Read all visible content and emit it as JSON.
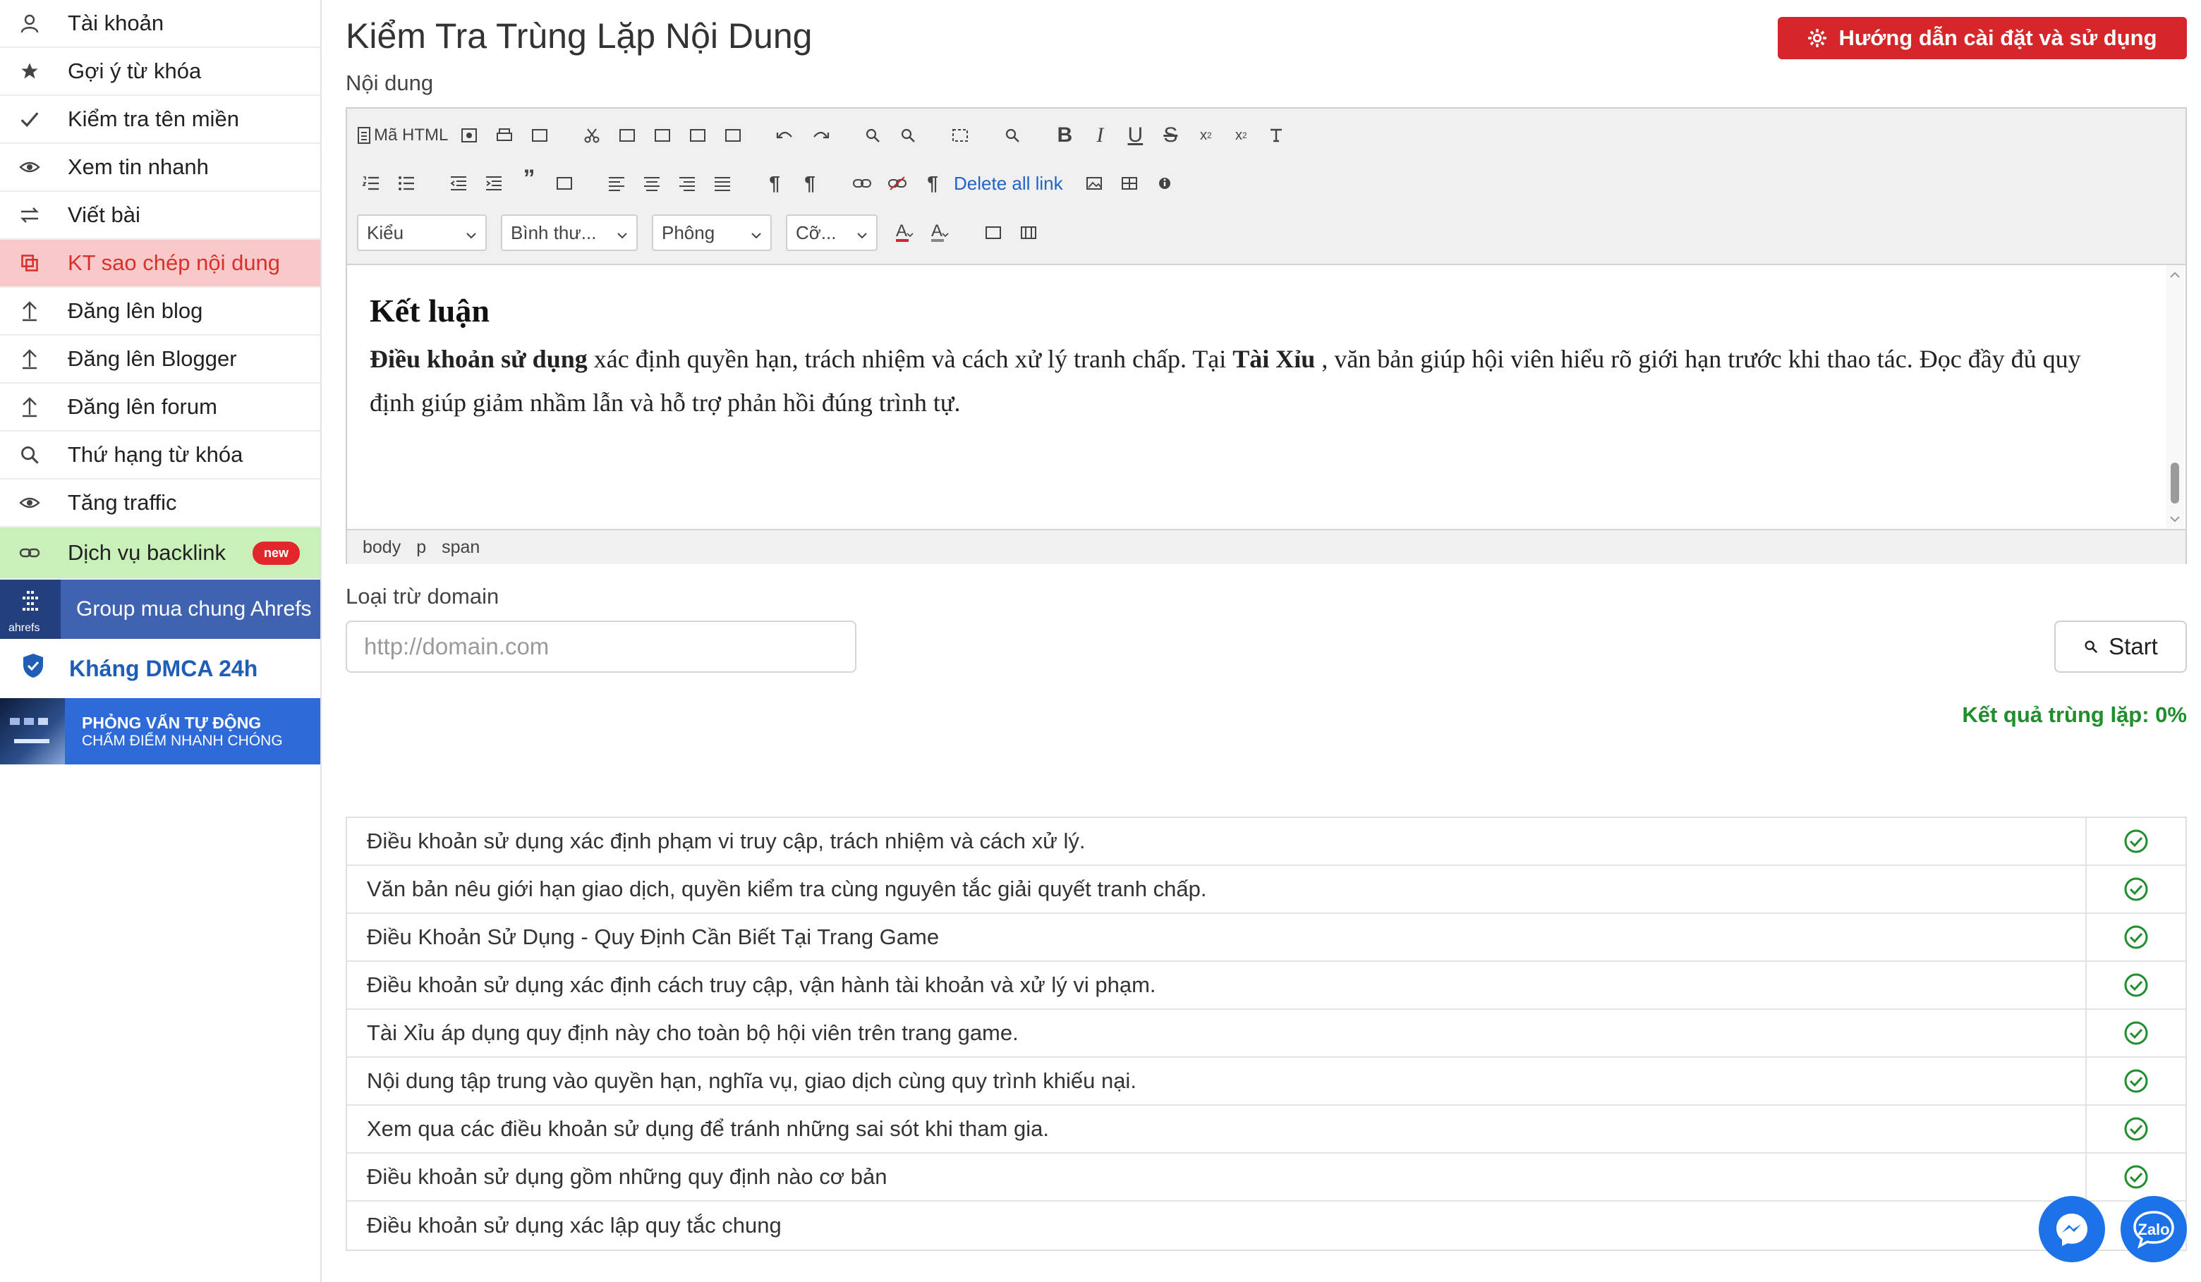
{
  "sidebar": {
    "items": [
      {
        "label": "Tài khoản",
        "icon": "user-icon"
      },
      {
        "label": "Gợi ý từ khóa",
        "icon": "star-icon"
      },
      {
        "label": "Kiểm tra tên miền",
        "icon": "check-icon"
      },
      {
        "label": "Xem tin nhanh",
        "icon": "eye-icon"
      },
      {
        "label": "Viết bài",
        "icon": "swap-icon"
      },
      {
        "label": "KT sao chép nội dung",
        "icon": "copy-icon"
      },
      {
        "label": "Đăng lên blog",
        "icon": "upload-icon"
      },
      {
        "label": "Đăng lên Blogger",
        "icon": "upload-icon"
      },
      {
        "label": "Đăng lên forum",
        "icon": "upload-icon"
      },
      {
        "label": "Thứ hạng từ khóa",
        "icon": "search-icon"
      },
      {
        "label": "Tăng traffic",
        "icon": "eye-icon"
      },
      {
        "label": "Dịch vụ backlink",
        "icon": "link-icon",
        "badge": "new"
      }
    ],
    "active_index": 5,
    "ahrefs": {
      "logo_text": "ahrefs",
      "label": "Group mua chung Ahrefs"
    },
    "dmca": {
      "label": "Kháng DMCA 24h"
    },
    "interview": {
      "line1": "PHỎNG VẤN TỰ ĐỘNG",
      "line2": "CHẤM ĐIỂM NHANH CHÓNG"
    }
  },
  "header": {
    "title": "Kiểm Tra Trùng Lặp Nội Dung",
    "help_button": "Hướng dẫn cài đặt và sử dụng"
  },
  "editor": {
    "label": "Nội dung",
    "toolbar": {
      "html_button": "Mã HTML",
      "delete_all_link": "Delete all link",
      "style_select": "Kiểu",
      "format_select": "Bình thư...",
      "font_select": "Phông",
      "size_select": "Cỡ..."
    },
    "content": {
      "heading": "Kết luận",
      "para_bold1": "Điều khoản sử dụng",
      "para_text1": " xác định quyền hạn, trách nhiệm và cách xử lý tranh chấp. Tại ",
      "para_bold2": "Tài Xỉu",
      "para_text2": " , văn bản giúp hội viên hiểu rõ giới hạn trước khi thao tác. Đọc đầy đủ quy định giúp giảm nhầm lẫn và hỗ trợ phản hồi đúng trình tự."
    },
    "status_path": [
      "body",
      "p",
      "span"
    ]
  },
  "exclude": {
    "label": "Loại trừ domain",
    "placeholder": "http://domain.com",
    "value": ""
  },
  "start_button": "Start",
  "result": {
    "text": "Kết quả trùng lặp: 0%"
  },
  "results": [
    "Điều khoản sử dụng xác định phạm vi truy cập, trách nhiệm và cách xử lý.",
    "Văn bản nêu giới hạn giao dịch, quyền kiểm tra cùng nguyên tắc giải quyết tranh chấp.",
    "Điều Khoản Sử Dụng - Quy Định Cần Biết Tại Trang Game",
    "Điều khoản sử dụng xác định cách truy cập, vận hành tài khoản và xử lý vi phạm.",
    "Tài Xỉu áp dụng quy định này cho toàn bộ hội viên trên trang game.",
    "Nội dung tập trung vào quyền hạn, nghĩa vụ, giao dịch cùng quy trình khiếu nại.",
    "Xem qua các điều khoản sử dụng để tránh những sai sót khi tham gia.",
    "Điều khoản sử dụng gồm những quy định nào cơ bản",
    "Điều khoản sử dụng xác lập quy tắc chung"
  ],
  "floating": {
    "zalo_label": "Zalo"
  },
  "colors": {
    "accent_red": "#d6262a",
    "success_green": "#1e8f2a",
    "link_blue": "#1f64c9"
  }
}
